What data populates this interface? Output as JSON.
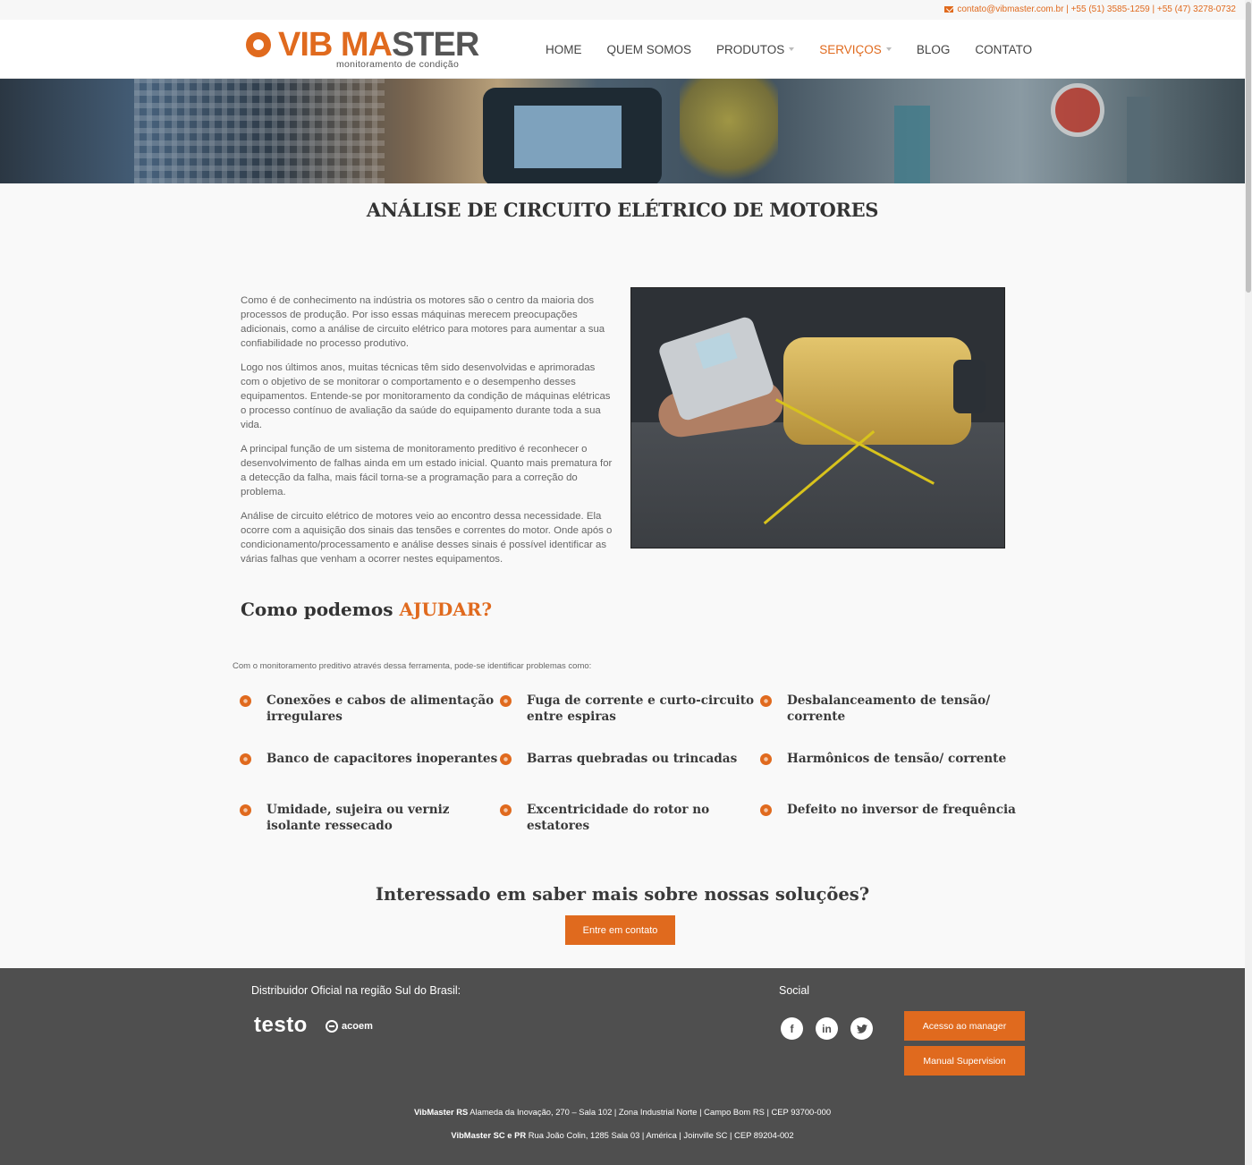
{
  "topbar": {
    "contact": "contato@vibmaster.com.br | +55 (51) 3585-1259 | +55 (47) 3278-0732"
  },
  "brand": {
    "name_part1": "VIB MA",
    "name_part2": "STER",
    "tagline": "monitoramento de condição",
    "accent_color": "#e06a1e"
  },
  "nav": {
    "items": [
      {
        "label": "HOME"
      },
      {
        "label": "QUEM SOMOS"
      },
      {
        "label": "PRODUTOS"
      },
      {
        "label": "SERVIÇOS"
      },
      {
        "label": "BLOG"
      },
      {
        "label": "CONTATO"
      }
    ]
  },
  "page": {
    "title": "ANÁLISE DE CIRCUITO ELÉTRICO DE MOTORES",
    "paragraphs": [
      "Como é de conhecimento na indústria os motores são o centro da maioria dos processos de produção. Por isso essas máquinas merecem preocupações adicionais, como a análise de circuito elétrico para motores para aumentar a sua confiabilidade no processo produtivo.",
      "Logo nos últimos anos, muitas técnicas têm sido desenvolvidas e aprimoradas com o objetivo de se monitorar o comportamento e o desempenho desses equipamentos. Entende-se por monitoramento da condição de máquinas elétricas o processo contínuo de avaliação da saúde do equipamento durante toda a sua vida.",
      "A principal função de um sistema de monitoramento preditivo é reconhecer o desenvolvimento de falhas ainda em um estado inicial. Quanto mais prematura for a detecção da falha, mais fácil torna-se a programação para a correção do problema.",
      "Análise de circuito elétrico de motores veio ao encontro dessa necessidade. Ela ocorre com a aquisição dos sinais das tensões e correntes do motor. Onde após o condicionamento/processamento e análise desses sinais é possível identificar as várias falhas que venham a ocorrer nestes equipamentos."
    ]
  },
  "help": {
    "title_part1": "Como podemos ",
    "title_part2": "AJUDAR?",
    "subtitle": "Com o monitoramento preditivo através dessa ferramenta, pode-se identificar problemas como:",
    "problems": [
      "Conexões e cabos de alimentação irregulares",
      "Fuga de corrente e curto-circuito entre espiras",
      "Desbalanceamento de tensão/ corrente",
      "Banco de capacitores inoperantes",
      "Barras quebradas ou trincadas",
      "Harmônicos de tensão/ corrente",
      "Umidade, sujeira ou verniz isolante ressecado",
      "Excentricidade do rotor no estatores",
      "Defeito no inversor de frequência"
    ]
  },
  "cta": {
    "title": "Interessado em saber mais sobre nossas soluções?",
    "button": "Entre em contato"
  },
  "footer": {
    "distributor": "Distribuidor Oficial na região Sul do Brasil:",
    "partner1": "testo",
    "partner2": "acoem",
    "social_title": "Social",
    "social_icons": [
      "facebook-icon",
      "linkedin-icon",
      "twitter-icon"
    ],
    "button_manager": "Acesso ao manager",
    "button_supervision": "Manual Supervision",
    "address1_label": "VibMaster RS",
    "address1": " Alameda da Inovação, 270 – Sala 102 | Zona Industrial Norte | Campo Bom RS | CEP 93700-000",
    "address2_label": "VibMaster SC e PR",
    "address2": " Rua João Colin, 1285 Sala 03 | América | Joinville SC | CEP 89204-002"
  }
}
